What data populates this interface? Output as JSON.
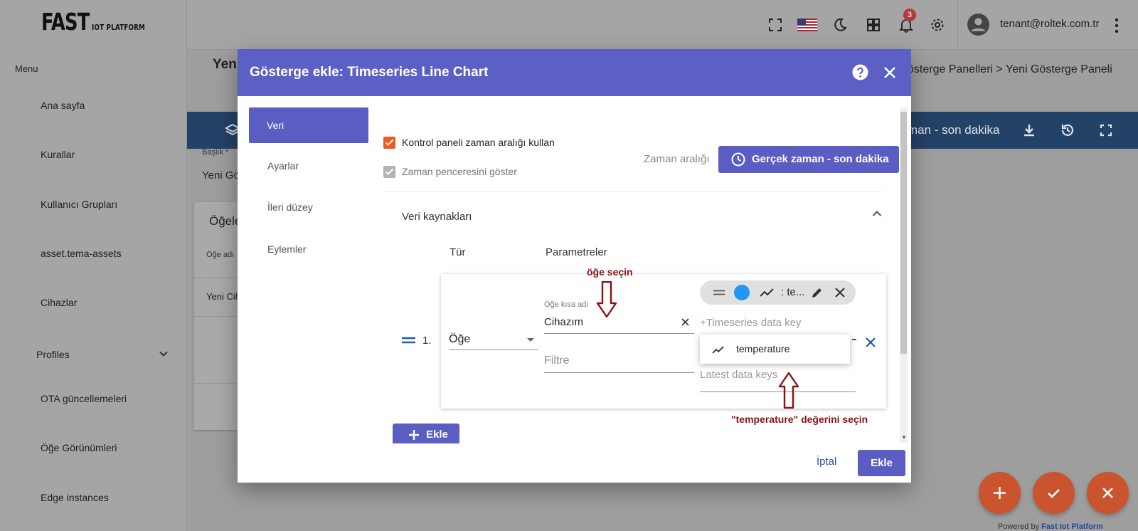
{
  "brand": {
    "name_big": "FAST",
    "name_small": "IOT PLATFORM"
  },
  "sidebar": {
    "menu_title": "Menu",
    "items": [
      {
        "label": "Ana sayfa"
      },
      {
        "label": "Kurallar"
      },
      {
        "label": "Kullanıcı Grupları"
      },
      {
        "label": "asset.tema-assets"
      },
      {
        "label": "Cihazlar"
      },
      {
        "label": "Profiles"
      },
      {
        "label": "OTA güncellemeleri"
      },
      {
        "label": "Öğe Görünümleri"
      },
      {
        "label": "Edge instances"
      }
    ]
  },
  "topbar": {
    "notification_count": "3",
    "user_email": "tenant@roltek.com.tr",
    "icons": [
      "fullscreen-icon",
      "us-flag-icon",
      "moon-icon",
      "apps-icon",
      "bell-icon",
      "gear-icon",
      "account-icon",
      "more-vert-icon"
    ]
  },
  "background": {
    "page_title": "Yeni",
    "breadcrumb": "österge Panelleri  >  Yeni Gösterge Paneli",
    "toolbar_time": "man - son dakika",
    "title_label": "Başlık *",
    "title_value": "Yeni Gö",
    "card_title": "Öğele",
    "card_label": "Öğe adı",
    "card_row": "Yeni Cih"
  },
  "dialog": {
    "title": "Gösterge ekle: Timeseries Line Chart",
    "tabs": [
      {
        "label": "Veri",
        "active": true
      },
      {
        "label": "Ayarlar",
        "active": false
      },
      {
        "label": "İleri düzey",
        "active": false
      },
      {
        "label": "Eylemler",
        "active": false
      }
    ],
    "use_dashboard_timewindow": {
      "label": "Kontrol paneli zaman aralığı kullan",
      "checked": true
    },
    "display_timewindow": {
      "label": "Zaman penceresini göster",
      "checked": true,
      "disabled": true
    },
    "time_range_label": "Zaman aralığı",
    "time_range_button": "Gerçek zaman - son dakika",
    "datasources": {
      "title": "Veri kaynakları",
      "col_type": "Tür",
      "col_params": "Parametreler",
      "rows": [
        {
          "index": "1.",
          "type": "Öğe",
          "entity_label": "Öğe kısa adı",
          "entity_value": "Cihazım",
          "filter_placeholder": "Filtre",
          "key_chip_text": ": te...",
          "key_chip_color": "#2196f3",
          "timeseries_placeholder": "+Timeseries data key",
          "latest_placeholder": "Latest data keys",
          "dropdown_option": "temperature"
        }
      ],
      "add_button": "Ekle"
    },
    "cancel_button": "İptal",
    "submit_button": "Ekle"
  },
  "annotations": {
    "entity_hint": "öğe seçin",
    "key_hint": "\"temperature\" değerini seçin"
  },
  "footer": {
    "powered_prefix": "Powered by",
    "powered_brand": "Fast Iot Platform"
  },
  "colors": {
    "accent": "#5a5ec3",
    "header": "#5c5fc3",
    "checkbox": "#f05a22",
    "fab": "#c9542d",
    "annotation": "#8c1111"
  }
}
